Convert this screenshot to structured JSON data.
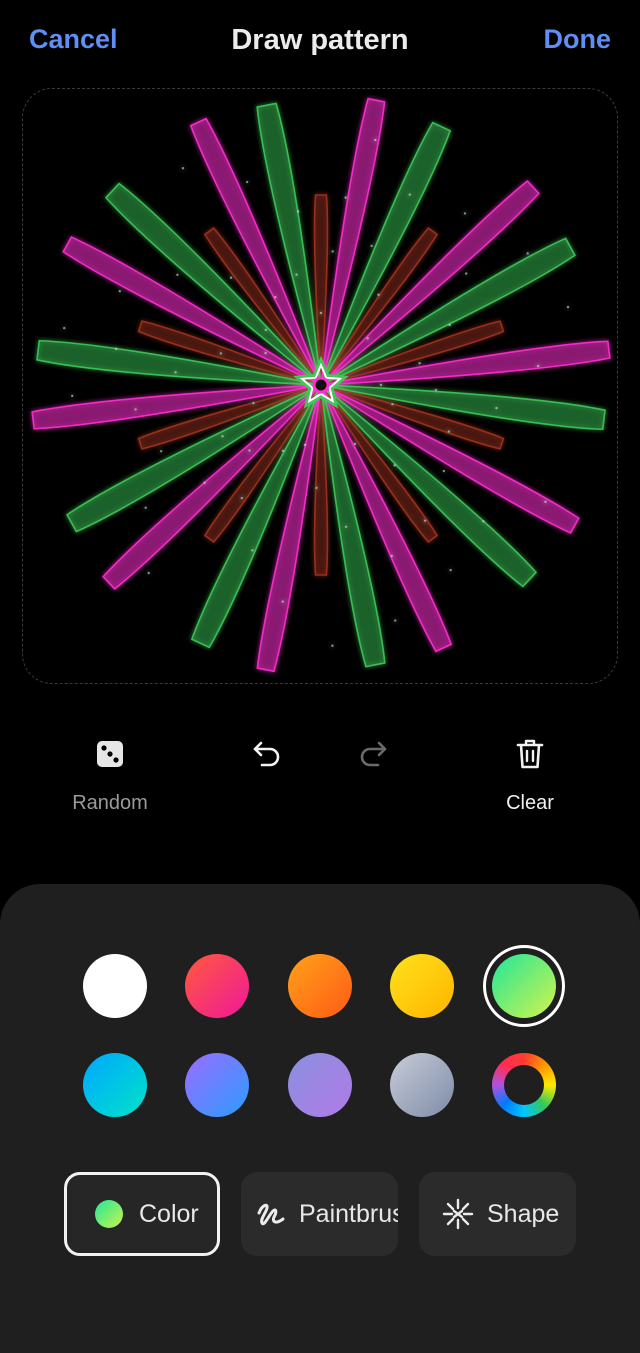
{
  "header": {
    "cancel_label": "Cancel",
    "title": "Draw pattern",
    "done_label": "Done"
  },
  "canvas": {
    "pattern": "kaleidoscope-starburst",
    "colors": [
      "#ff2fd0",
      "#3ec95a",
      "#a0341f",
      "#ffffff"
    ]
  },
  "tools": {
    "random_label": "Random",
    "random_icon": "dice-icon",
    "undo_icon": "undo-icon",
    "redo_icon": "redo-icon",
    "clear_label": "Clear",
    "clear_icon": "trash-icon"
  },
  "palette": {
    "colors": [
      {
        "name": "white",
        "fill": "#ffffff"
      },
      {
        "name": "red-pink",
        "fill": "linear-gradient(135deg,#ff5a3c,#f0189a)"
      },
      {
        "name": "orange",
        "fill": "linear-gradient(135deg,#ffa21a,#ff5a14)"
      },
      {
        "name": "yellow",
        "fill": "linear-gradient(135deg,#ffe21a,#ffb400)"
      },
      {
        "name": "green",
        "fill": "linear-gradient(135deg,#1fe79a,#d5f34c)",
        "selected": true
      },
      {
        "name": "cyan",
        "fill": "linear-gradient(135deg,#00a6ff,#00e3c8)"
      },
      {
        "name": "blue-violet",
        "fill": "linear-gradient(135deg,#9c6cff,#2b9cff)"
      },
      {
        "name": "lavender",
        "fill": "linear-gradient(135deg,#8a90e0,#b07ae6)"
      },
      {
        "name": "gray-blue",
        "fill": "linear-gradient(135deg,#c9ccd8,#7d8ca8)"
      },
      {
        "name": "color-wheel",
        "fill": "conic"
      }
    ]
  },
  "modes": {
    "color_label": "Color",
    "paintbrush_label": "Paintbrush",
    "shape_label": "Shape",
    "paintbrush_icon": "paintbrush-squiggle-icon",
    "shape_icon": "sparkle-shape-icon"
  }
}
